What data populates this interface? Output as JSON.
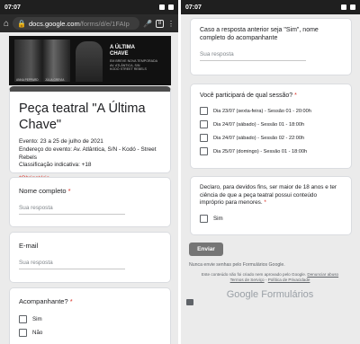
{
  "left": {
    "status": {
      "time": "07:07"
    },
    "urlbar": {
      "host": "docs.google.com",
      "path": "/forms/d/e/1FAIp"
    },
    "banner": {
      "title": "A ÚLTIMA\nCHAVE",
      "subtitle": "EM BREVE NOVA TEMPORADA\nAV. ATLÂNTICA, S/N\nKODÓ STREET REBELS",
      "caption1": "ANNA PEPPARD",
      "caption2": "JÚLIA GREVIA"
    },
    "form": {
      "title": "Peça teatral \"A Última Chave\"",
      "description": "Evento: 23 a 25 de julho de 2021\nEndereço do evento: Av. Atlântica, S/N - Kodó - Street Rebels\nClassificação indicativa: +18",
      "required_note": "*Obrigatório"
    },
    "q_name": {
      "label": "Nome completo",
      "star": "*",
      "placeholder": "Sua resposta"
    },
    "q_email": {
      "label": "E-mail",
      "placeholder": "Sua resposta"
    },
    "q_companion": {
      "label": "Acompanhante?",
      "star": "*",
      "options": [
        "Sim",
        "Não"
      ]
    }
  },
  "right": {
    "status": {
      "time": "07:07"
    },
    "q_companion_name": {
      "label": "Caso a resposta anterior seja \"Sim\", nome completo do acompanhante",
      "placeholder": "Sua resposta"
    },
    "q_session": {
      "label": "Você participará de qual sessão?",
      "star": "*",
      "options": [
        "Dia 23/07 (sexta-feira) - Sessão 01 - 20:00h",
        "Dia 24/07 (sábado) - Sessão 01 - 18:00h",
        "Dia 24/07 (sábado) - Sessão 02 - 22:00h",
        "Dia 25/07 (domingo) - Sessão 01 - 18:00h"
      ]
    },
    "q_declare": {
      "label": "Declaro, para devidos fins, ser maior de 18 anos e ter ciência de que a peça teatral possui conteúdo impróprio para menores.",
      "star": "*",
      "option": "Sim"
    },
    "submit": "Enviar",
    "never_passwords": "Nunca envie senhas pelo Formulários Google.",
    "disclaimer": "Este conteúdo não foi criado nem aprovado pelo Google.",
    "report_link": "Denunciar abuso",
    "terms_link": "Termos de Serviço",
    "privacy_link": "Política de Privacidade",
    "sep": " - ",
    "brand": "Google Formulários"
  }
}
